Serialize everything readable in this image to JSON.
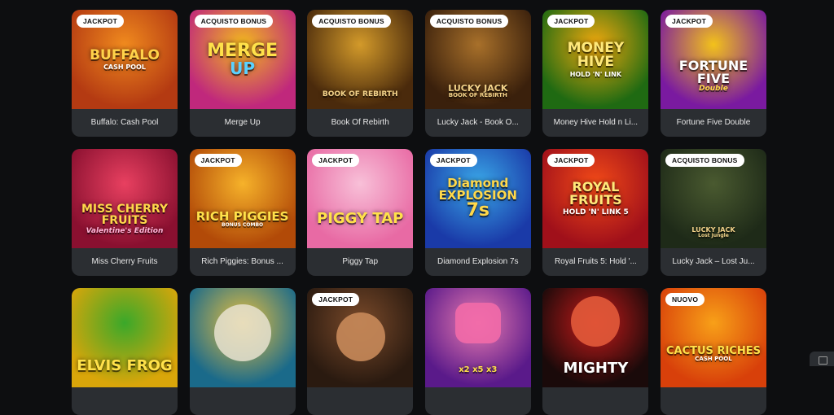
{
  "games": [
    {
      "name": "Buffalo: Cash Pool",
      "badge": "JACKPOT",
      "art": "BUFFALO",
      "art2": "CASH POOL",
      "bg": "#b43a12",
      "bg2": "#f08a1e"
    },
    {
      "name": "Merge Up",
      "badge": "ACQUISTO BONUS",
      "art": "MERGE",
      "art2": "UP",
      "bg": "#c0287c",
      "bg2": "#f2b91e"
    },
    {
      "name": "Book Of Rebirth",
      "badge": "ACQUISTO BONUS",
      "art": "BOOK OF REBIRTH",
      "art2": "",
      "bg": "#4a2a0c",
      "bg2": "#d39a2a"
    },
    {
      "name": "Lucky Jack - Book O...",
      "badge": "ACQUISTO BONUS",
      "art": "LUCKY JACK",
      "art2": "BOOK OF REBIRTH",
      "bg": "#3a200c",
      "bg2": "#a8702a"
    },
    {
      "name": "Money Hive Hold n Li...",
      "badge": "JACKPOT",
      "art": "MONEY HIVE",
      "art2": "HOLD 'N' LINK",
      "bg": "#1f6a12",
      "bg2": "#f0a80e"
    },
    {
      "name": "Fortune Five Double",
      "badge": "JACKPOT",
      "art": "FORTUNE FIVE",
      "art2": "Double",
      "bg": "#7a1aa0",
      "bg2": "#f3c21a"
    },
    {
      "name": "Miss Cherry Fruits",
      "badge": "",
      "art": "MISS CHERRY FRUITS",
      "art2": "Valentine's Edition",
      "bg": "#8a1030",
      "bg2": "#e84060"
    },
    {
      "name": "Rich Piggies: Bonus ...",
      "badge": "JACKPOT",
      "art": "RICH PIGGIES",
      "art2": "BONUS COMBO",
      "bg": "#b24a08",
      "bg2": "#f6b22a"
    },
    {
      "name": "Piggy Tap",
      "badge": "JACKPOT",
      "art": "PIGGY TAP",
      "art2": "",
      "bg": "#e86aa4",
      "bg2": "#f8c0d8"
    },
    {
      "name": "Diamond Explosion 7s",
      "badge": "JACKPOT",
      "art": "Diamond EXPLOSION",
      "art2": "7s",
      "bg": "#1a3aa8",
      "bg2": "#3aa8e8"
    },
    {
      "name": "Royal Fruits 5: Hold '...",
      "badge": "JACKPOT",
      "art": "ROYAL FRUITS",
      "art2": "HOLD 'N' LINK 5",
      "bg": "#a0101a",
      "bg2": "#f24a18"
    },
    {
      "name": "Lucky Jack – Lost Ju...",
      "badge": "ACQUISTO BONUS",
      "art": "LUCKY JACK",
      "art2": "Lost Jungle",
      "bg": "#1e2a18",
      "bg2": "#4a5a30"
    },
    {
      "name": "",
      "badge": "",
      "art": "ELVIS FROG",
      "art2": "",
      "bg": "#d9a60a",
      "bg2": "#3aa82a"
    },
    {
      "name": "",
      "badge": "",
      "art": "",
      "art2": "",
      "bg": "#1a6a8a",
      "bg2": "#e8c040"
    },
    {
      "name": "",
      "badge": "JACKPOT",
      "art": "",
      "art2": "",
      "bg": "#2a1a10",
      "bg2": "#7a4a2a"
    },
    {
      "name": "",
      "badge": "",
      "art": "x2 x5 x3",
      "art2": "",
      "bg": "#5a1a8a",
      "bg2": "#e87ab0"
    },
    {
      "name": "",
      "badge": "",
      "art": "MIGHTY",
      "art2": "",
      "bg": "#1a0a0a",
      "bg2": "#c81a1a"
    },
    {
      "name": "",
      "badge": "NUOVO",
      "art": "CACTUS RICHES",
      "art2": "CASH POOL",
      "bg": "#d8400a",
      "bg2": "#f8a018"
    }
  ]
}
